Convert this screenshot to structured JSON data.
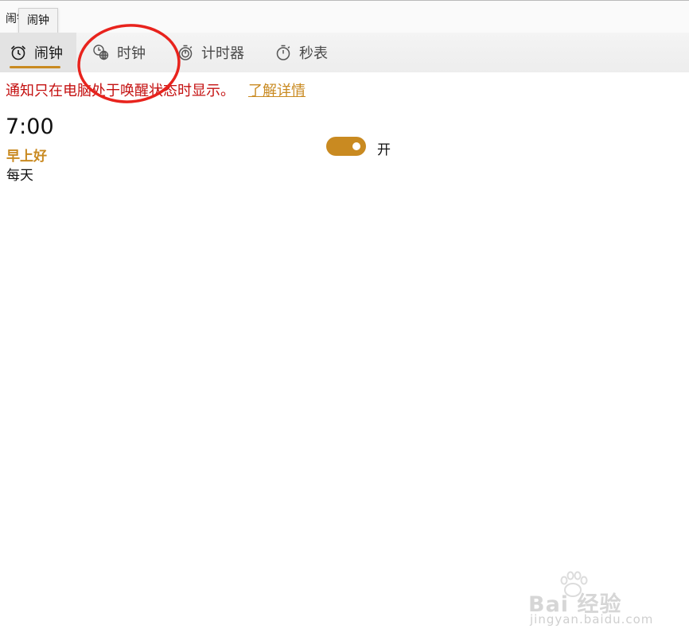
{
  "window": {
    "title": "闹钟"
  },
  "tooltip": {
    "text": "闹钟"
  },
  "tabs": [
    {
      "label": "闹钟",
      "icon": "alarm-clock-icon",
      "active": true
    },
    {
      "label": "时钟",
      "icon": "world-clock-icon",
      "active": false
    },
    {
      "label": "计时器",
      "icon": "timer-icon",
      "active": false
    },
    {
      "label": "秒表",
      "icon": "stopwatch-icon",
      "active": false
    }
  ],
  "notice": {
    "text": "通知只在电脑处于唤醒状态时显示。",
    "link": "了解详情"
  },
  "alarms": [
    {
      "time": "7:00",
      "name": "早上好",
      "repeat": "每天",
      "toggle_label": "开",
      "enabled": true
    }
  ],
  "watermark": {
    "brand": "Bai 经验",
    "sub": "jingyan.baidu.com"
  },
  "colors": {
    "accent": "#c98a21",
    "notice": "#c41010",
    "annotation": "#e8231d"
  }
}
